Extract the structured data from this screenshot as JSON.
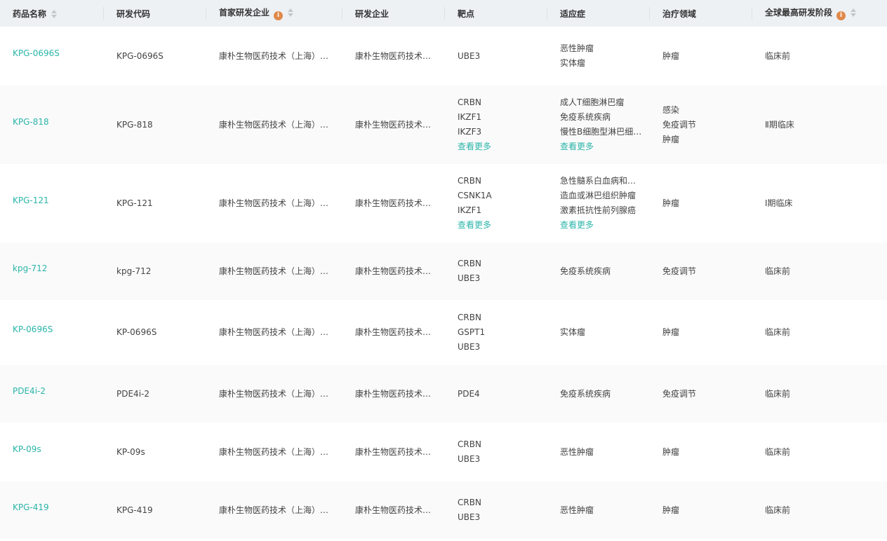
{
  "columns": [
    {
      "label": "药品名称",
      "info": false,
      "sortable": true
    },
    {
      "label": "研发代码",
      "info": false,
      "sortable": false
    },
    {
      "label": "首家研发企业",
      "info": true,
      "sortable": true
    },
    {
      "label": "研发企业",
      "info": false,
      "sortable": false
    },
    {
      "label": "靶点",
      "info": false,
      "sortable": false
    },
    {
      "label": "适应症",
      "info": false,
      "sortable": false
    },
    {
      "label": "治疗领域",
      "info": false,
      "sortable": false
    },
    {
      "label": "全球最高研发阶段",
      "info": true,
      "sortable": true
    }
  ],
  "more_label": "查看更多",
  "info_glyph": "i",
  "rows": [
    {
      "name": "KPG-0696S",
      "code": "KPG-0696S",
      "first_company": "康朴生物医药技术（上海）有限公司",
      "company": "康朴生物医药技术（上海）有限公司",
      "targets": [
        "UBE3"
      ],
      "targets_more": false,
      "indications": [
        "恶性肿瘤",
        "实体瘤"
      ],
      "indications_more": false,
      "areas": [
        "肿瘤"
      ],
      "stage": "临床前",
      "height": 84
    },
    {
      "name": "KPG-818",
      "code": "KPG-818",
      "first_company": "康朴生物医药技术（上海）有限公司",
      "company": "康朴生物医药技术（上海）有限公司",
      "targets": [
        "CRBN",
        "IKZF1",
        "IKZF3"
      ],
      "targets_more": true,
      "indications": [
        "成人T细胞淋巴瘤",
        "免疫系统疾病",
        "慢性B细胞型淋巴细胞白血病"
      ],
      "indications_more": true,
      "areas": [
        "感染",
        "免疫调节",
        "肿瘤"
      ],
      "stage": "Ⅱ期临床",
      "height": 112
    },
    {
      "name": "KPG-121",
      "code": "KPG-121",
      "first_company": "康朴生物医药技术（上海）有限公司",
      "company": "康朴生物医药技术（上海）有限公司",
      "targets": [
        "CRBN",
        "CSNK1A",
        "IKZF1"
      ],
      "targets_more": true,
      "indications": [
        "急性髓系白血病和相关疾病",
        "造血或淋巴组织肿瘤",
        "激素抵抗性前列腺癌"
      ],
      "indications_more": true,
      "areas": [
        "肿瘤"
      ],
      "stage": "Ⅰ期临床",
      "height": 112
    },
    {
      "name": "kpg-712",
      "code": "kpg-712",
      "first_company": "康朴生物医药技术（上海）有限公司",
      "company": "康朴生物医药技术（上海）有限公司",
      "targets": [
        "CRBN",
        "UBE3"
      ],
      "targets_more": false,
      "indications": [
        "免疫系统疾病"
      ],
      "indications_more": false,
      "areas": [
        "免疫调节"
      ],
      "stage": "临床前",
      "height": 82
    },
    {
      "name": "KP-0696S",
      "code": "KP-0696S",
      "first_company": "康朴生物医药技术（上海）有限公司",
      "company": "康朴生物医药技术（上海）有限公司",
      "targets": [
        "CRBN",
        "GSPT1",
        "UBE3"
      ],
      "targets_more": false,
      "indications": [
        "实体瘤"
      ],
      "indications_more": false,
      "areas": [
        "肿瘤"
      ],
      "stage": "临床前",
      "height": 93
    },
    {
      "name": "PDE4i-2",
      "code": "PDE4i-2",
      "first_company": "康朴生物医药技术（上海）有限公司",
      "company": "康朴生物医药技术（上海）有限公司",
      "targets": [
        "PDE4"
      ],
      "targets_more": false,
      "indications": [
        "免疫系统疾病"
      ],
      "indications_more": false,
      "areas": [
        "免疫调节"
      ],
      "stage": "临床前",
      "height": 82
    },
    {
      "name": "KP-09s",
      "code": "KP-09s",
      "first_company": "康朴生物医药技术（上海）有限公司",
      "company": "康朴生物医药技术（上海）有限公司",
      "targets": [
        "CRBN",
        "UBE3"
      ],
      "targets_more": false,
      "indications": [
        "恶性肿瘤"
      ],
      "indications_more": false,
      "areas": [
        "肿瘤"
      ],
      "stage": "临床前",
      "height": 84
    },
    {
      "name": "KPG-419",
      "code": "KPG-419",
      "first_company": "康朴生物医药技术（上海）有限公司",
      "company": "康朴生物医药技术（上海）有限公司",
      "targets": [
        "CRBN",
        "UBE3"
      ],
      "targets_more": false,
      "indications": [
        "恶性肿瘤"
      ],
      "indications_more": false,
      "areas": [
        "肿瘤"
      ],
      "stage": "临床前",
      "height": 82
    }
  ]
}
